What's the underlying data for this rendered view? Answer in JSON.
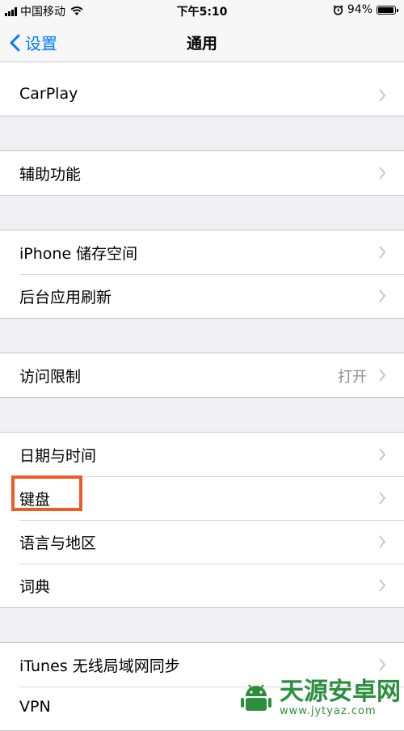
{
  "status_bar": {
    "carrier": "中国移动",
    "time": "下午5:10",
    "battery_percent": "94%",
    "battery_level": 0.94
  },
  "nav": {
    "back_label": "设置",
    "title": "通用"
  },
  "groups": [
    {
      "rows": [
        {
          "label": "CarPlay"
        }
      ]
    },
    {
      "rows": [
        {
          "label": "辅助功能"
        }
      ]
    },
    {
      "rows": [
        {
          "label": "iPhone 储存空间"
        },
        {
          "label": "后台应用刷新"
        }
      ]
    },
    {
      "rows": [
        {
          "label": "访问限制",
          "value": "打开"
        }
      ]
    },
    {
      "rows": [
        {
          "label": "日期与时间"
        },
        {
          "label": "键盘"
        },
        {
          "label": "语言与地区"
        },
        {
          "label": "词典"
        }
      ]
    },
    {
      "rows": [
        {
          "label": "iTunes 无线局域网同步"
        },
        {
          "label": "VPN"
        }
      ]
    }
  ],
  "watermark": {
    "title": "天源安卓网",
    "url": "www.jytyaz.com"
  },
  "colors": {
    "accent": "#007aff",
    "highlight": "#f05a23",
    "watermark": "#2c8f3e"
  },
  "icons": [
    "wifi-icon",
    "alarm-icon",
    "back-chevron-icon",
    "chevron-right-icon",
    "android-logo-icon"
  ]
}
